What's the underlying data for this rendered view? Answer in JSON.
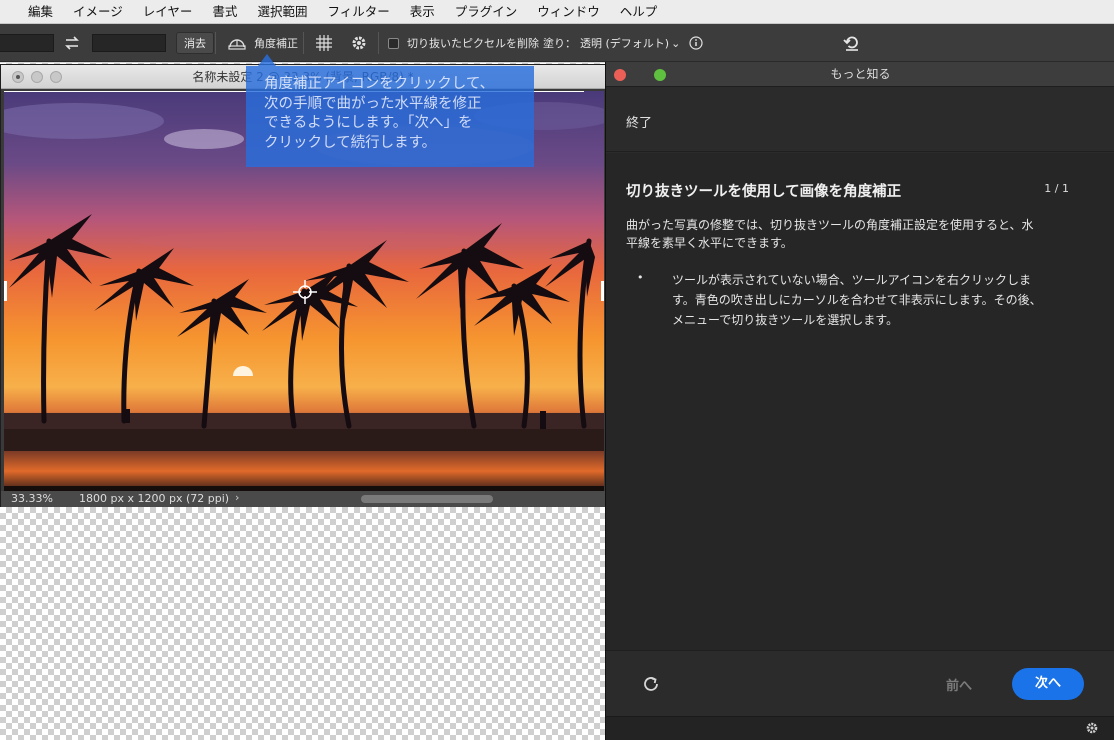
{
  "menubar": {
    "items": [
      "編集",
      "イメージ",
      "レイヤー",
      "書式",
      "選択範囲",
      "フィルター",
      "表示",
      "プラグイン",
      "ウィンドウ",
      "ヘルプ"
    ]
  },
  "options_bar": {
    "clear_label": "消去",
    "straighten_label": "角度補正",
    "delete_cropped_label": "切り抜いたピクセルを削除",
    "fill_label": "塗り：",
    "fill_value": "透明 (デフォルト)"
  },
  "document": {
    "title": "名称未設定 2 @ 33.3% (背景, RGB/8) *",
    "zoom": "33.33%",
    "dimensions": "1800 px x 1200 px (72 ppi)"
  },
  "tooltip": {
    "lines": [
      "角度補正アイコンをクリックして、",
      "次の手順で曲がった水平線を修正",
      "できるようにします。「次へ」を",
      "クリックして続行します。"
    ]
  },
  "panel": {
    "window_title": "もっと知る",
    "exit_label": "終了",
    "heading": "切り抜きツールを使用して画像を角度補正",
    "page_indicator": "1 / 1",
    "intro_lines": [
      "曲がった写真の修整では、切り抜きツールの角度補正設定を使用すると、水",
      "平線を素早く水平にできます。"
    ],
    "bullet_lines": [
      "ツールが表示されていない場合、ツールアイコンを右クリックしま",
      "す。青色の吹き出しにカーソルを合わせて非表示にします。その後、",
      "メニューで切り抜きツールを選択します。"
    ],
    "prev_label": "前へ",
    "next_label": "次へ"
  },
  "colors": {
    "accent_blue": "#1a73e8",
    "tooltip_blue": "#2f6ed6",
    "panel_bg": "#262626",
    "close_red": "#ec5f56",
    "zoom_green": "#5fc03f"
  },
  "icons": [
    "swap-arrows-icon",
    "straighten-icon",
    "grid-overlay-icon",
    "gear-icon",
    "info-icon",
    "undo-reset-icon",
    "refresh-icon",
    "chevron-right-icon"
  ]
}
